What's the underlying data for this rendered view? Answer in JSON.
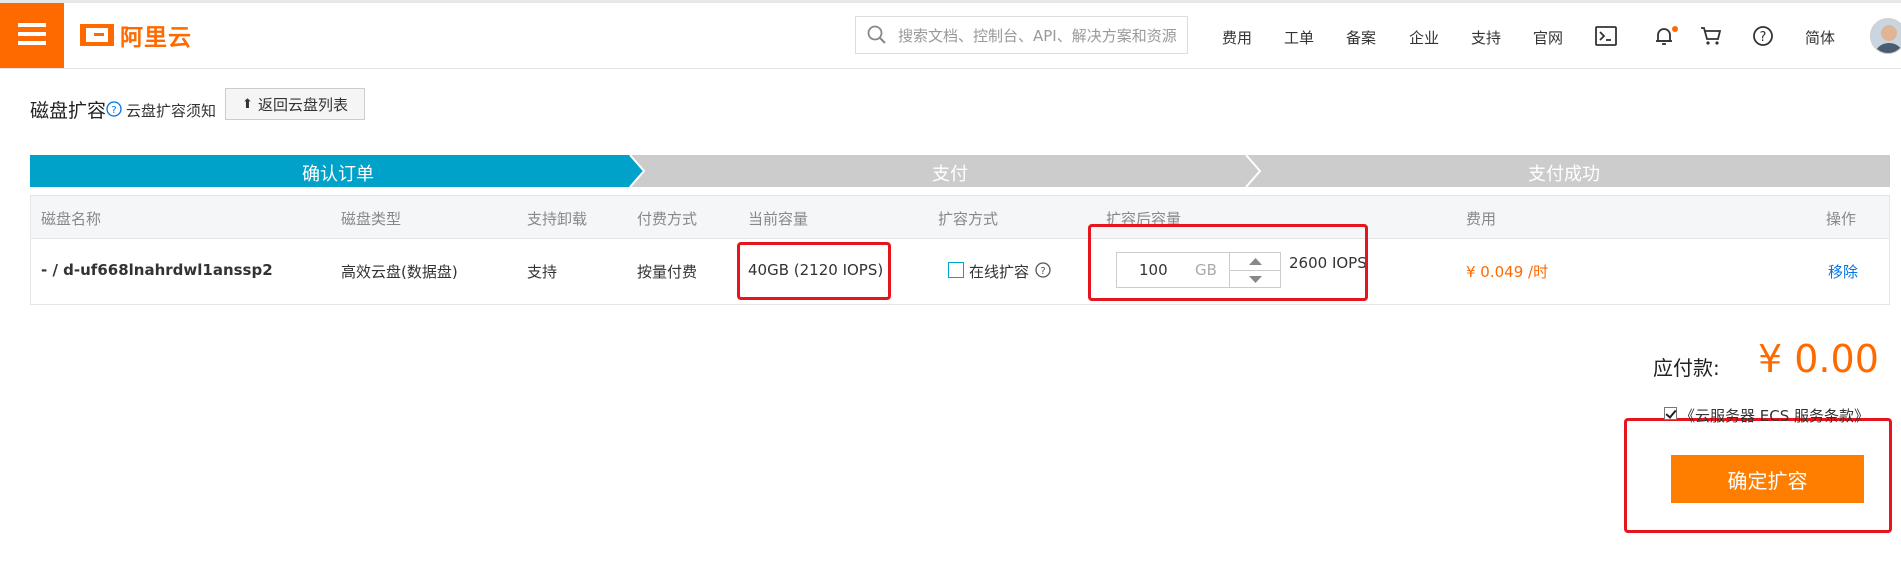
{
  "header": {
    "logo_text": "阿里云",
    "search_placeholder": "搜索文档、控制台、API、解决方案和资源",
    "nav": [
      "费用",
      "工单",
      "备案",
      "企业",
      "支持",
      "官网"
    ],
    "lang": "简体",
    "icons": [
      "terminal-icon",
      "bell-icon",
      "cart-icon",
      "help-icon"
    ]
  },
  "page": {
    "title": "磁盘扩容",
    "notice_link": "云盘扩容须知",
    "back_button": "返回云盘列表"
  },
  "steps": [
    "确认订单",
    "支付",
    "支付成功"
  ],
  "table": {
    "headers": [
      "磁盘名称",
      "磁盘类型",
      "支持卸载",
      "付费方式",
      "当前容量",
      "扩容方式",
      "扩容后容量",
      "费用",
      "操作"
    ],
    "row": {
      "name": "- / d-uf668lnahrdwl1anssp2",
      "type": "高效云盘(数据盘)",
      "detachable": "支持",
      "billing": "按量付费",
      "current_capacity": "40GB (2120 IOPS)",
      "expand_method": "在线扩容",
      "new_capacity_value": "100",
      "new_capacity_unit": "GB",
      "new_iops": "2600 IOPS",
      "fee": "¥ 0.049 /时",
      "action": "移除"
    }
  },
  "footer": {
    "pay_label": "应付款:",
    "pay_amount": "¥ 0.00",
    "agreement": "《云服务器 ECS 服务条款》",
    "confirm_button": "确定扩容"
  },
  "colors": {
    "brand": "#ff6a00",
    "step_active": "#00a2ca",
    "step_inactive": "#cccccc",
    "highlight": "#e6141e",
    "link": "#0073e6"
  }
}
